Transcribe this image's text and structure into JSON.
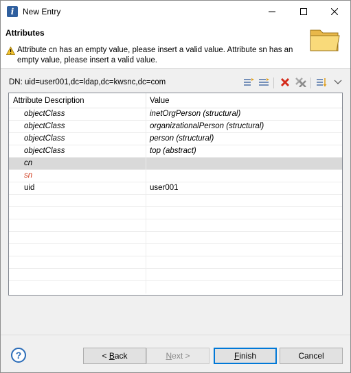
{
  "window": {
    "title": "New Entry"
  },
  "header": {
    "title": "Attributes",
    "message": "Attribute cn has an empty value, please insert a valid value. Attribute sn has an empty value, please insert a valid value."
  },
  "dn": {
    "label": "DN: uid=user001,dc=ldap,dc=kwsnc,dc=com"
  },
  "toolbar": {
    "icons": [
      "new-attribute-icon",
      "new-value-icon",
      "delete-icon",
      "delete-all-icon",
      "sort-icon",
      "view-menu-icon"
    ]
  },
  "table": {
    "headers": {
      "description": "Attribute Description",
      "value": "Value"
    },
    "rows": [
      {
        "description": "objectClass",
        "value": "inetOrgPerson (structural)",
        "style": "italic"
      },
      {
        "description": "objectClass",
        "value": "organizationalPerson (structural)",
        "style": "italic"
      },
      {
        "description": "objectClass",
        "value": "person (structural)",
        "style": "italic"
      },
      {
        "description": "objectClass",
        "value": "top (abstract)",
        "style": "italic"
      },
      {
        "description": "cn",
        "value": "",
        "style": "italic-selected"
      },
      {
        "description": "sn",
        "value": "",
        "style": "italic-error"
      },
      {
        "description": "uid",
        "value": "user001",
        "style": "normal"
      }
    ]
  },
  "buttons": {
    "help": "?",
    "back_prefix": "< ",
    "back_mnemonic": "B",
    "back_rest": "ack",
    "next_prefix": "",
    "next_mnemonic": "N",
    "next_rest": "ext >",
    "finish_mnemonic": "F",
    "finish_rest": "inish",
    "cancel": "Cancel"
  },
  "colors": {
    "error": "#d03a1c",
    "selected_row": "#d9d9d9",
    "accent": "#0078d7"
  }
}
